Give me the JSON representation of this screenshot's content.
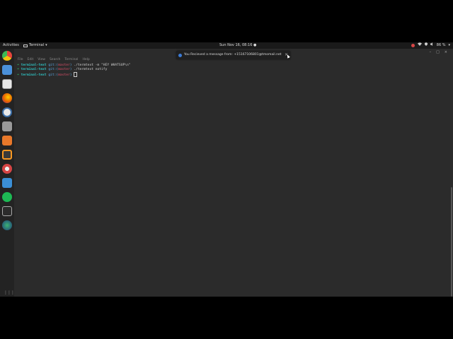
{
  "topbar": {
    "activities": "Activities",
    "app_name": "Terminal",
    "app_chevron": "▾",
    "clock": "Sun Nov 16, 08:16 ●",
    "battery": "86 %",
    "chevron": "▾"
  },
  "dock": {
    "items": [
      {
        "name": "chrome-icon",
        "color": "#e8453c"
      },
      {
        "name": "files-icon",
        "color": "#4a90d9"
      },
      {
        "name": "text-editor-icon",
        "color": "#f0f0f0"
      },
      {
        "name": "firefox-icon",
        "color": "#e66000"
      },
      {
        "name": "clock-icon",
        "color": "#3c6fa8"
      },
      {
        "name": "camera-icon",
        "color": "#9a9a9a"
      },
      {
        "name": "software-center-icon",
        "color": "#e8782a"
      },
      {
        "name": "sublime-icon",
        "color": "#f89822"
      },
      {
        "name": "settings-icon",
        "color": "#d64545"
      },
      {
        "name": "tasks-icon",
        "color": "#3b8fd6"
      },
      {
        "name": "spotify-icon",
        "color": "#1db954"
      },
      {
        "name": "terminal-icon",
        "color": "#2b2b2b"
      },
      {
        "name": "globe-icon",
        "color": "#1f6b3a"
      }
    ],
    "apps_grid": "⋮⋮⋮"
  },
  "terminal": {
    "menu": [
      "File",
      "Edit",
      "View",
      "Search",
      "Terminal",
      "Help"
    ],
    "lines": [
      {
        "arrow": "➜",
        "path": "terminal-text",
        "git": "git:(",
        "branch": "master",
        "git_end": ")",
        "command": " ./termtext -m \"HEY WHATSUP\\n\""
      },
      {
        "arrow": "➜",
        "path": "terminal-text",
        "git": "git:(",
        "branch": "master",
        "git_end": ")",
        "command": " ./termtext notify"
      },
      {
        "arrow": "➜",
        "path": "terminal-text",
        "git": "git:(",
        "branch": "master",
        "git_end": ")",
        "command": " "
      }
    ],
    "window_controls": {
      "minimize": "–",
      "maximize": "□",
      "close": "×"
    }
  },
  "notification": {
    "text": "You Recieved a message from: +15167106801@tmomail.net",
    "close": "×"
  },
  "colors": {
    "accent_green": "#2ecc71",
    "path_cyan": "#2ec4c4",
    "branch_red": "#e0506a"
  }
}
